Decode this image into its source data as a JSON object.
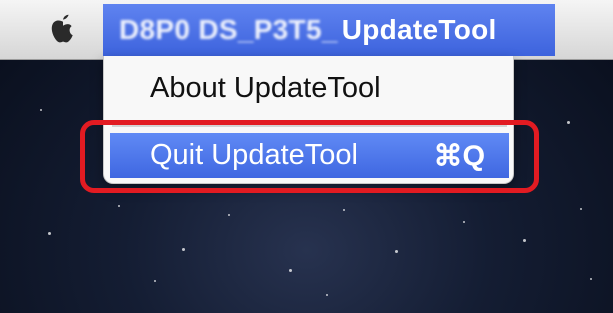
{
  "menubar": {
    "apple_icon": "apple-icon",
    "app_menu": {
      "obscured_prefix": "D8P0 DS_P3T5_",
      "label": "UpdateTool"
    }
  },
  "dropdown": {
    "items": [
      {
        "label": "About UpdateTool"
      },
      {
        "label": "Quit UpdateTool",
        "shortcut": "⌘Q",
        "highlighted": true
      }
    ]
  },
  "colors": {
    "menu_highlight": "#4f78ea",
    "annotation_box": "#e21b22"
  }
}
